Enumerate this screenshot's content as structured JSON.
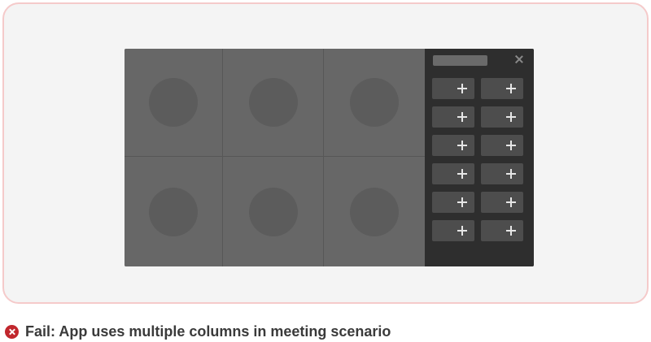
{
  "caption": {
    "icon": "fail-icon",
    "text": "Fail: App uses multiple columns in meeting scenario",
    "icon_color": "#c1272d"
  },
  "meeting": {
    "video_tiles": [
      {
        "icon": "avatar-placeholder"
      },
      {
        "icon": "avatar-placeholder"
      },
      {
        "icon": "avatar-placeholder"
      },
      {
        "icon": "avatar-placeholder"
      },
      {
        "icon": "avatar-placeholder"
      },
      {
        "icon": "avatar-placeholder"
      }
    ],
    "side_panel": {
      "close_icon": "close-icon",
      "add_buttons": [
        {
          "icon": "plus-icon"
        },
        {
          "icon": "plus-icon"
        },
        {
          "icon": "plus-icon"
        },
        {
          "icon": "plus-icon"
        },
        {
          "icon": "plus-icon"
        },
        {
          "icon": "plus-icon"
        },
        {
          "icon": "plus-icon"
        },
        {
          "icon": "plus-icon"
        },
        {
          "icon": "plus-icon"
        },
        {
          "icon": "plus-icon"
        },
        {
          "icon": "plus-icon"
        },
        {
          "icon": "plus-icon"
        }
      ]
    }
  },
  "colors": {
    "frame_border": "#f5caca",
    "frame_background": "#f4f4f4",
    "stage": "#656565",
    "panel": "#2e2e2e",
    "add_tile": "#4d4d4d"
  }
}
